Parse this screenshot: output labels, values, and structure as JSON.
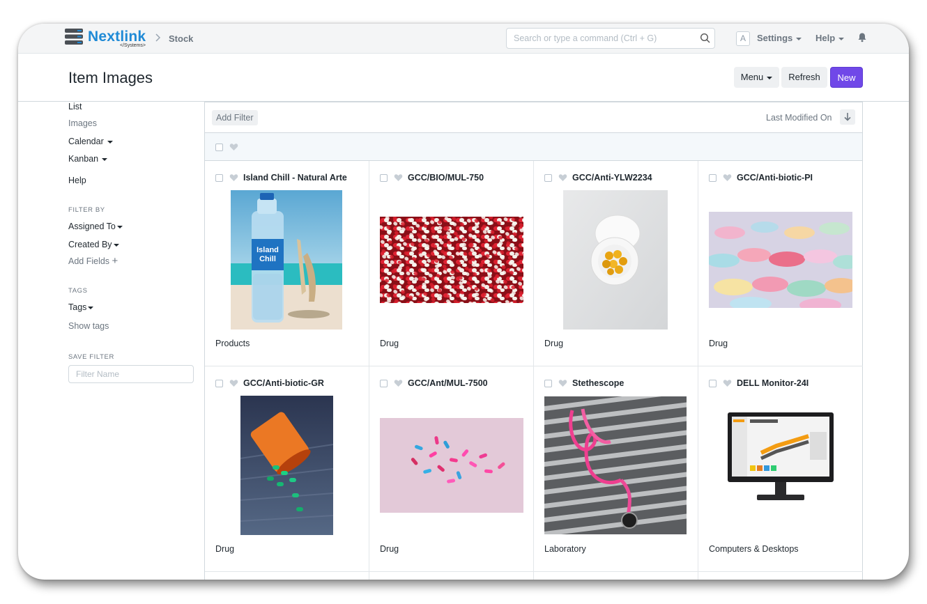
{
  "navbar": {
    "brand": "Nextlink",
    "brand_sub": "</Systems>",
    "breadcrumb": "Stock",
    "search_placeholder": "Search or type a command (Ctrl + G)",
    "avatar_letter": "A",
    "settings_label": "Settings",
    "help_label": "Help"
  },
  "page": {
    "title": "Item Images",
    "menu_label": "Menu",
    "refresh_label": "Refresh",
    "new_label": "New"
  },
  "sidebar": {
    "views": [
      "List",
      "Images",
      "Calendar",
      "Kanban",
      "Help"
    ],
    "filter_by_heading": "FILTER BY",
    "assigned_to": "Assigned To",
    "created_by": "Created By",
    "add_fields": "Add Fields",
    "tags_heading": "TAGS",
    "tags": "Tags",
    "show_tags": "Show tags",
    "save_filter_heading": "SAVE FILTER",
    "filter_name_placeholder": "Filter Name"
  },
  "list": {
    "add_filter": "Add Filter",
    "sort_label": "Last Modified On",
    "items": [
      {
        "title": "Island Chill - Natural Arte",
        "group": "Products",
        "image": "water-bottle-beach"
      },
      {
        "title": "GCC/BIO/MUL-750",
        "group": "Drug",
        "image": "red-white-capsules"
      },
      {
        "title": "GCC/Anti-YLW2234",
        "group": "Drug",
        "image": "yellow-pills-bottle"
      },
      {
        "title": "GCC/Anti-biotic-PI",
        "group": "Drug",
        "image": "pastel-tablets"
      },
      {
        "title": "GCC/Anti-biotic-GR",
        "group": "Drug",
        "image": "orange-pill-bottle"
      },
      {
        "title": "GCC/Ant/MUL-7500",
        "group": "Drug",
        "image": "pink-blue-capsules"
      },
      {
        "title": "Stethescope",
        "group": "Laboratory",
        "image": "pink-stethoscope"
      },
      {
        "title": "DELL Monitor-24I",
        "group": "Computers & Desktops",
        "image": "dell-monitor"
      }
    ]
  },
  "colors": {
    "brand": "#1f8ad6",
    "primary": "#7048e8"
  }
}
